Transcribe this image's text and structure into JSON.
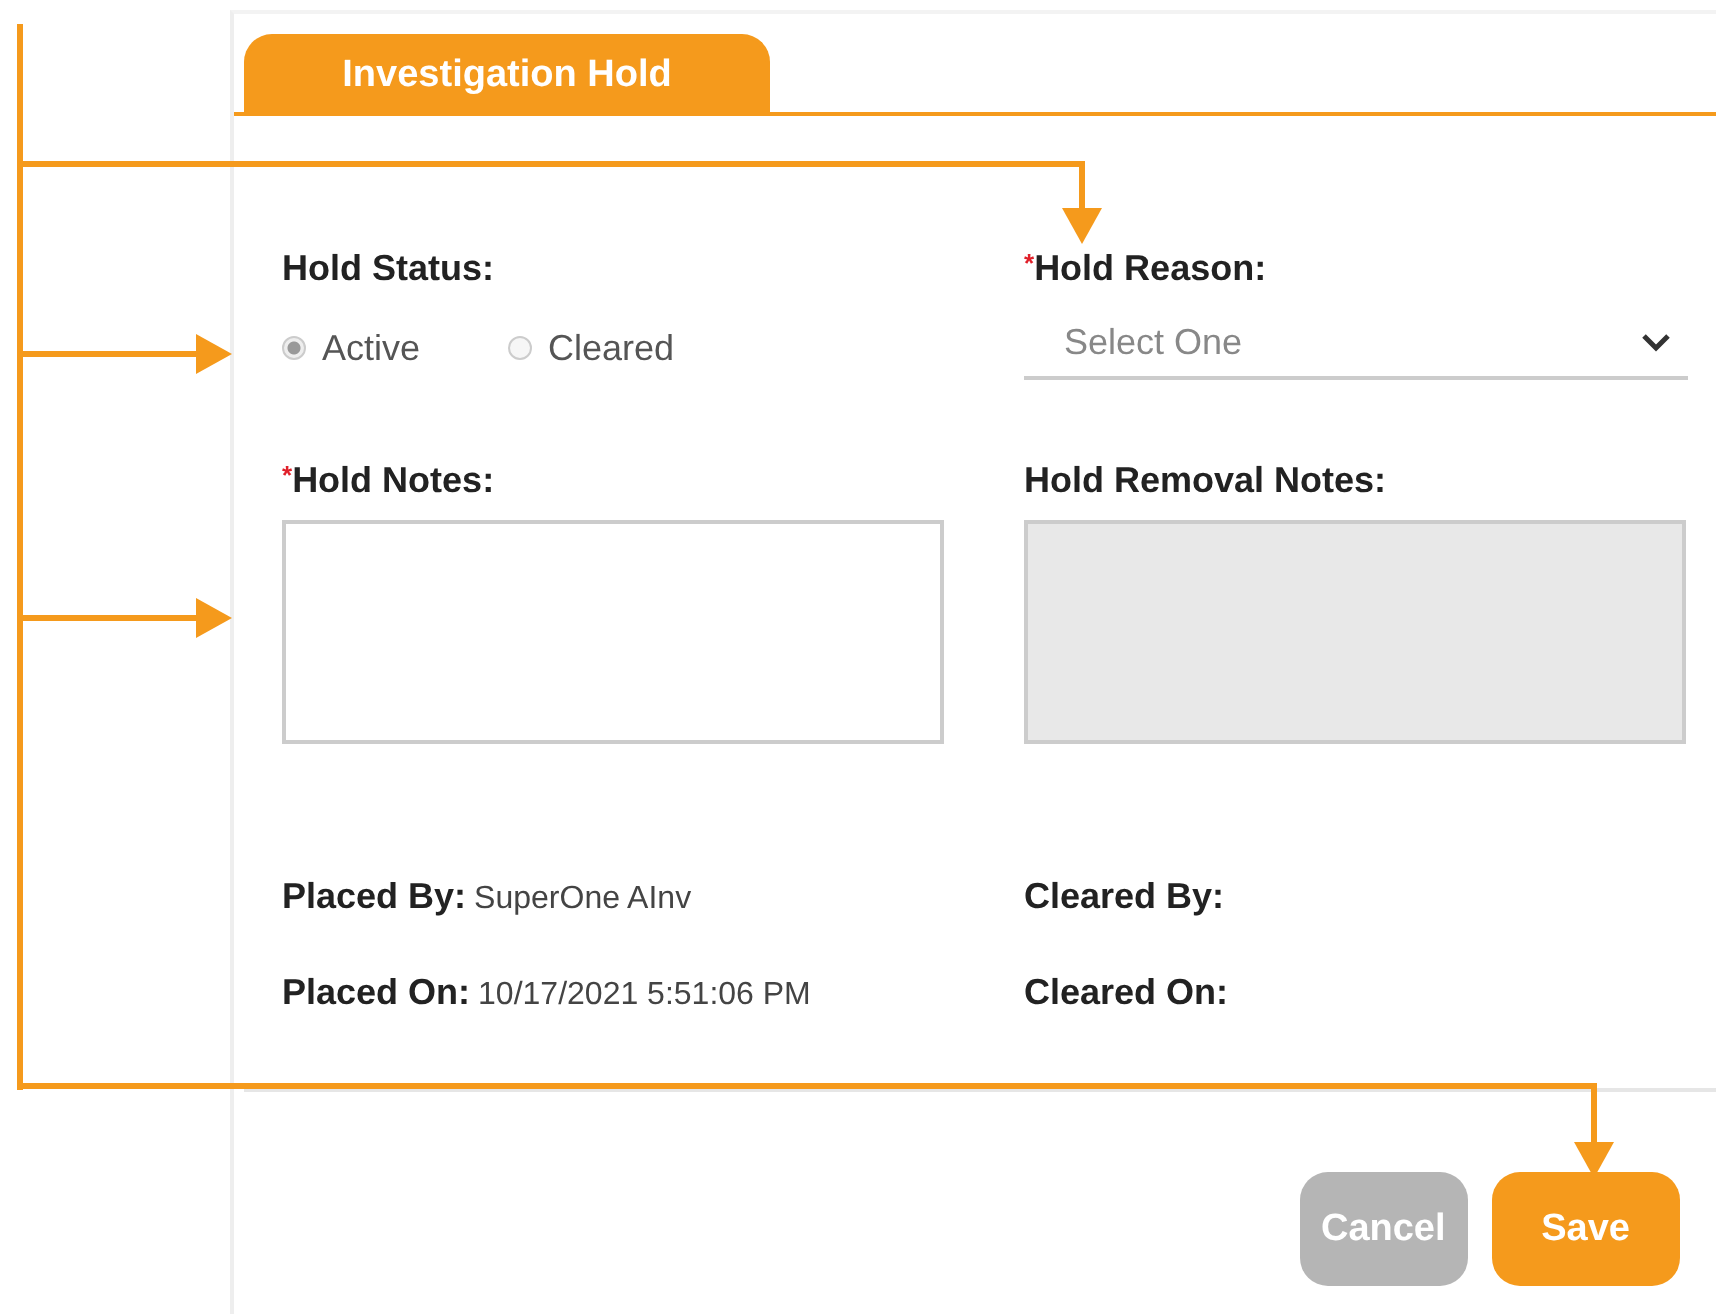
{
  "tab": {
    "label": "Investigation Hold",
    "selected": true
  },
  "hold_status": {
    "label": "Hold Status:",
    "disabled": true,
    "options": [
      {
        "label": "Active",
        "selected": true
      },
      {
        "label": "Cleared",
        "selected": false
      }
    ]
  },
  "hold_reason": {
    "label": "Hold Reason:",
    "required_mark": "*",
    "placeholder": "Select One"
  },
  "hold_notes": {
    "label": "Hold Notes:",
    "required_mark": "*",
    "disabled": false
  },
  "hold_removal_notes": {
    "label": "Hold Removal Notes:",
    "disabled": true
  },
  "info": [
    {
      "label": "Placed By:",
      "value": "SuperOne AInv"
    },
    {
      "label": "Cleared By:"
    },
    {
      "label": "Placed On:",
      "value": "10/17/2021 5:51:06 PM"
    },
    {
      "label": "Cleared On:"
    }
  ],
  "buttons": [
    {
      "label": "Cancel",
      "disabled": true
    },
    {
      "label": "Save",
      "disabled": false
    }
  ]
}
